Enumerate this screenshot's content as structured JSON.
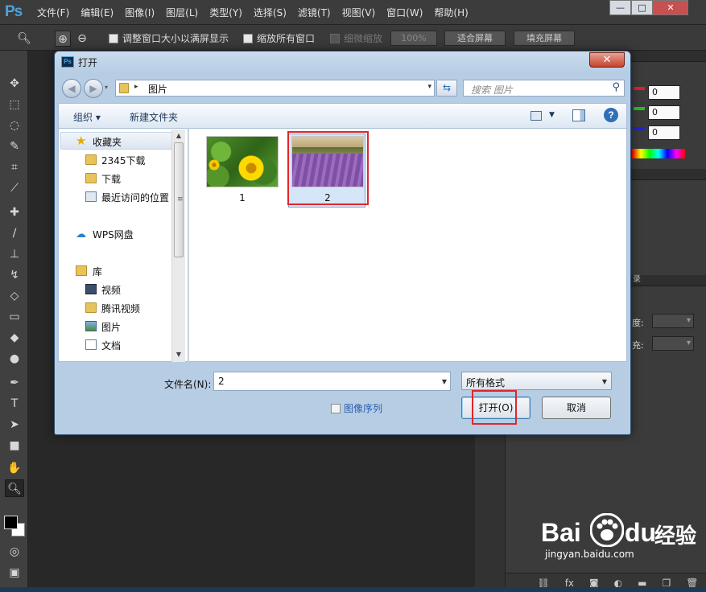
{
  "app": {
    "logo": "Ps",
    "menu": [
      "文件(F)",
      "编辑(E)",
      "图像(I)",
      "图层(L)",
      "类型(Y)",
      "选择(S)",
      "滤镜(T)",
      "视图(V)",
      "窗口(W)",
      "帮助(H)"
    ],
    "window_controls": [
      "—",
      "□",
      "✕"
    ]
  },
  "options_bar": {
    "resize_windows": "调整窗口大小以满屏显示",
    "zoom_all_windows": "缩放所有窗口",
    "scrubby_zoom": "细微缩放",
    "zoom_percent": "100%",
    "fit_screen": "适合屏幕",
    "fill_screen": "填充屏幕"
  },
  "panels": {
    "color_values": [
      "0",
      "0",
      "0"
    ],
    "opacity_suffix": "度:",
    "fill_suffix": "充:",
    "history_suffix": "录"
  },
  "dialog": {
    "title": "打开",
    "close_glyph": "✕",
    "address": {
      "current_folder": "图片",
      "separator": "▸"
    },
    "search_placeholder": "搜索 图片",
    "toolbar": {
      "organize": "组织 ▾",
      "new_folder": "新建文件夹",
      "help": "?"
    },
    "nav": {
      "favorites": "收藏夹",
      "fav_items": [
        "2345下载",
        "下载",
        "最近访问的位置"
      ],
      "wps": "WPS网盘",
      "library": "库",
      "lib_items": [
        "视频",
        "腾讯视频",
        "图片",
        "文档"
      ]
    },
    "files": [
      {
        "name": "1",
        "selected": false
      },
      {
        "name": "2",
        "selected": true
      }
    ],
    "filename_label": "文件名(N):",
    "filename_value": "2",
    "filetype_value": "所有格式",
    "image_sequence": "图像序列",
    "open_button": "打开(O)",
    "cancel_button": "取消"
  },
  "watermark": {
    "brand_left": "Bai",
    "brand_right": "du",
    "brand_cn": "经验",
    "url": "jingyan.baidu.com"
  },
  "colors": {
    "highlight": "#e0262c",
    "ps_blue": "#4aa3df"
  }
}
